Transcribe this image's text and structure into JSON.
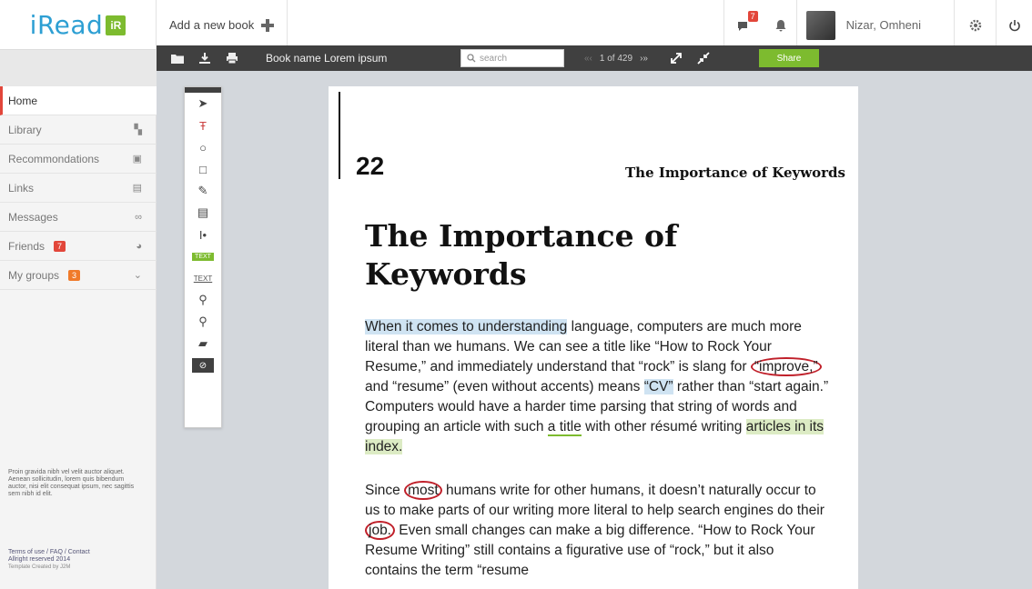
{
  "app": {
    "logo_text": "iRead",
    "logo_badge": "iR"
  },
  "topbar": {
    "add_book_label": "Add a new book",
    "notifications_count": "7",
    "user_name": "Nizar, Omheni"
  },
  "toolbar": {
    "book_name": "Book name Lorem ipsum",
    "search_placeholder": "search",
    "pager_prev": "«‹",
    "pager_text": "1 of 429",
    "pager_next": "›»",
    "share_label": "Share"
  },
  "sidebar": {
    "items": [
      {
        "label": "Home",
        "icon": ""
      },
      {
        "label": "Library",
        "icon": "library-icon"
      },
      {
        "label": "Recommondations",
        "icon": "image-icon"
      },
      {
        "label": "Links",
        "icon": "links-icon"
      },
      {
        "label": "Messages",
        "icon": "chain-icon"
      },
      {
        "label": "Friends",
        "badge": "7",
        "icon": "friends-icon"
      },
      {
        "label": "My groups",
        "badge": "3",
        "icon": "chevron-down-icon"
      }
    ],
    "about_text": "Proin gravida nibh vel velit auctor aliquet. Aenean sollicitudin, lorem quis bibendum auctor, nisi elit consequat ipsum, nec sagittis sem nibh id elit.",
    "footer_links": "Terms of use / FAQ / Contact",
    "footer_rights": "Allright reserved 2014",
    "footer_credit": "Template Created by J2M"
  },
  "tools": {
    "text_highlight_label": "TEXT",
    "text_underline_label": "TEXT"
  },
  "page": {
    "number": "22",
    "running_head": "The Importance of Keywords",
    "title": "The Importance of Keywords",
    "p1": {
      "hl_blue_1": "When it comes to understanding",
      "t1": " language, computers are much more literal than we humans. We can see a title like “How to Rock Your Resume,” and immediately understand that “rock” is slang for ",
      "circle_1": "“improve,”",
      "t2": " and “resume” (even without accents) means ",
      "hl_blue_2": "“CV”",
      "t3": " rather than “start again.” Computers would have a harder time parsing that string of words and grouping an article with such ",
      "underline": "a title",
      "t4": " with other résumé writing ",
      "hl_green": "articles in its index."
    },
    "p2": {
      "t1": "Since ",
      "circle_1": "most",
      "t2": " humans write for other humans, it doesn’t naturally occur to us to make parts of our writing more literal to help search engines do their ",
      "circle_2": "job.",
      "t3": " Even small changes can make a big difference. “How to Rock Your Resume Writing” still contains a figurative use of “rock,” but it also contains the term “resume"
    }
  },
  "colors": {
    "accent_blue": "#2d9fd3",
    "accent_green": "#7dbb2f",
    "badge_red": "#e2463a",
    "toolbar_dark": "#404040"
  }
}
